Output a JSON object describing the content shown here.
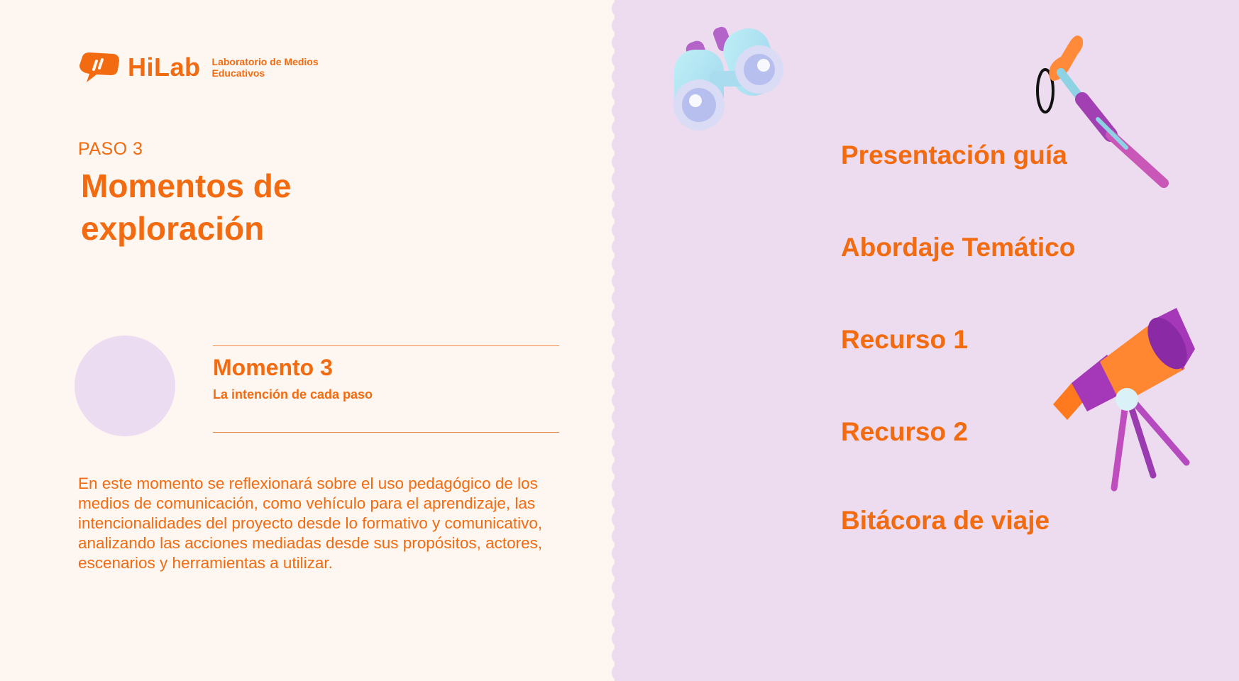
{
  "brand": {
    "name": "HiLab",
    "subtitle_line1": "Laboratorio de Medios",
    "subtitle_line2": "Educativos"
  },
  "step_label": "PASO 3",
  "title_line1": "Momentos de",
  "title_line2": "exploración",
  "moment": {
    "title": "Momento 3",
    "subtitle": "La intención de cada paso"
  },
  "description": "En este momento se reflexionará sobre el uso pedagógico de los medios de comunicación, como vehículo para el aprendizaje, las intencionalidades del proyecto desde lo formativo y comunicativo, analizando las acciones mediadas desde sus propósitos,  actores, escenarios y herramientas a utilizar.",
  "menu": {
    "items": [
      {
        "label": "Presentación guía"
      },
      {
        "label": "Abordaje Temático"
      },
      {
        "label": "Recurso 1"
      },
      {
        "label": "Recurso 2"
      },
      {
        "label": "Bitácora de viaje"
      }
    ]
  },
  "illustrations": [
    "binoculars-icon",
    "spyglass-icon",
    "telescope-icon"
  ],
  "colors": {
    "accent": "#f26b10",
    "left_bg": "#fef6f1",
    "right_bg": "#eddcef",
    "circle": "#ecdcf1"
  }
}
